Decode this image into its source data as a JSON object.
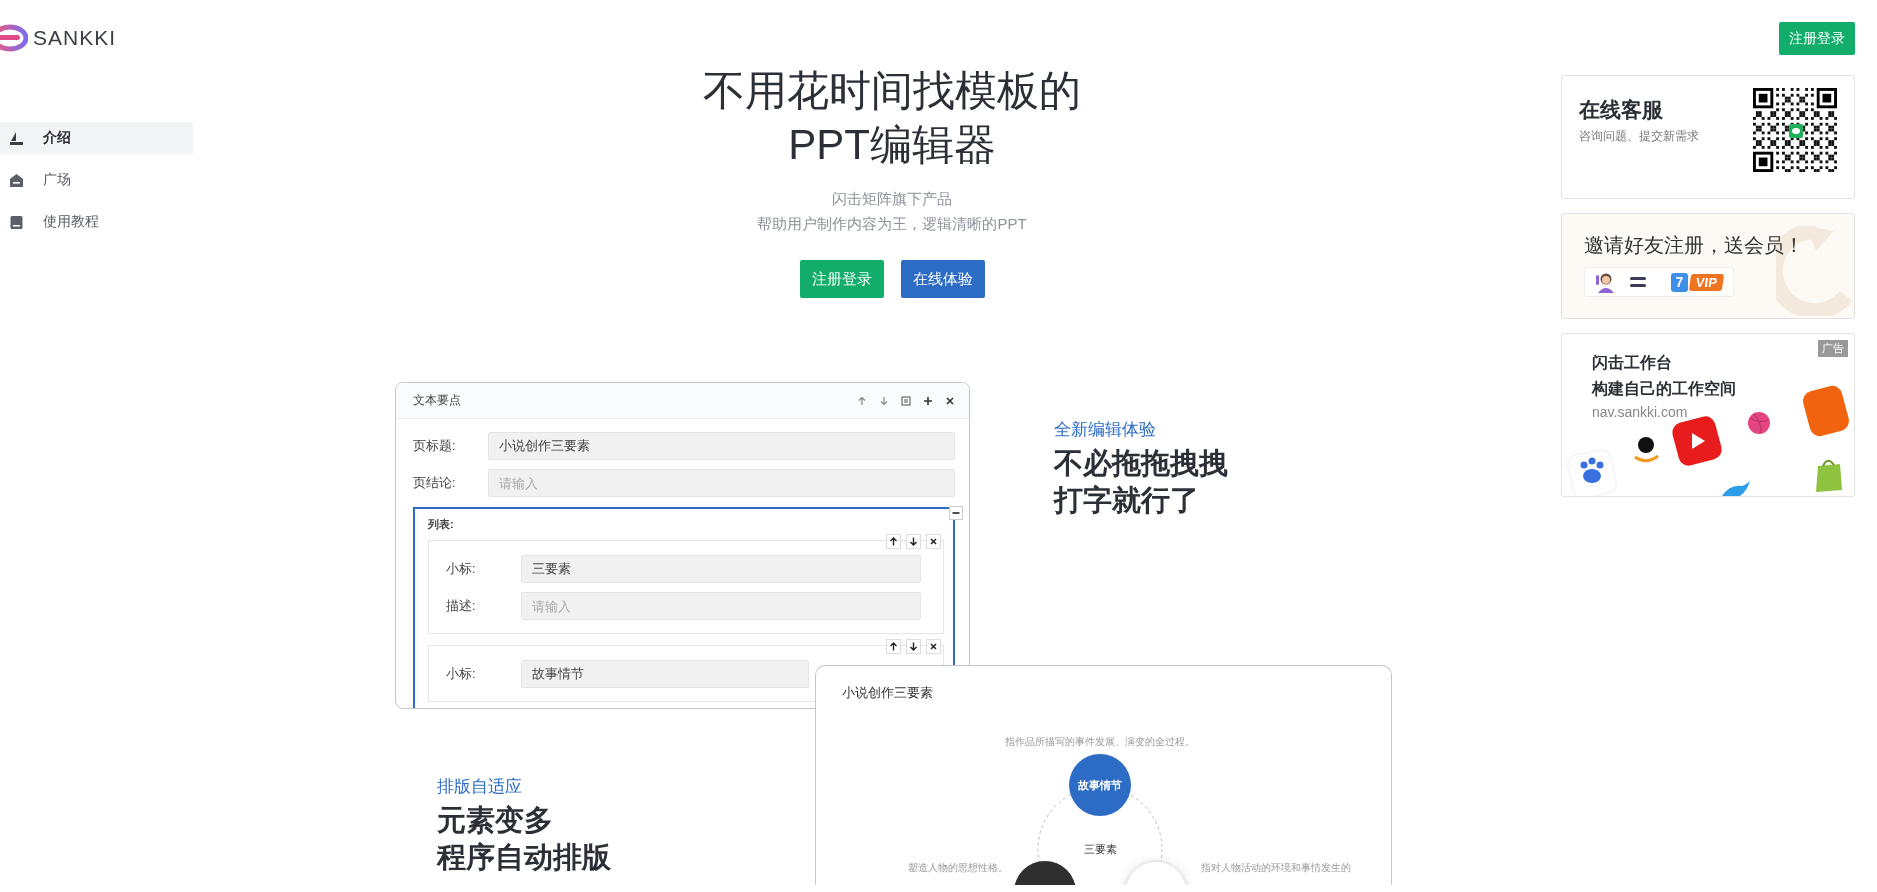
{
  "logo": {
    "text": "SANKKI"
  },
  "sidebar": {
    "items": [
      {
        "label": "介绍",
        "selected": true
      },
      {
        "label": "广场",
        "selected": false
      },
      {
        "label": "使用教程",
        "selected": false
      }
    ]
  },
  "hero": {
    "title_lines": [
      "不用花时间找模板的",
      "PPT编辑器"
    ],
    "subtitle_lines": [
      "闪击矩阵旗下产品",
      "帮助用户制作内容为王，逻辑清晰的PPT"
    ],
    "buttons": [
      {
        "label": "注册登录",
        "kind": "primary"
      },
      {
        "label": "在线体验",
        "kind": "secondary"
      }
    ]
  },
  "editor": {
    "title": "文本要点",
    "fields": [
      {
        "label": "页标题:",
        "value": "小说创作三要素"
      },
      {
        "label": "页结论:",
        "placeholder": "请输入"
      }
    ],
    "list": {
      "label": "列表:",
      "items": [
        {
          "fields": [
            {
              "label": "小标:",
              "value": "三要素"
            },
            {
              "label": "描述:",
              "placeholder": "请输入"
            }
          ]
        },
        {
          "fields": [
            {
              "label": "小标:",
              "value": "故事情节"
            }
          ]
        }
      ]
    }
  },
  "features": [
    {
      "kicker": "全新编辑体验",
      "heading_lines": [
        "不必拖拖拽拽",
        "打字就行了"
      ]
    },
    {
      "kicker": "排版自适应",
      "heading_lines": [
        "元素变多",
        "程序自动排版"
      ]
    }
  ],
  "slide": {
    "title": "小说创作三要素",
    "center_label": "三要素",
    "nodes": [
      {
        "kind": "blue",
        "label": "故事情节",
        "description": "指作品所描写的事件发展、演变的全过程。"
      },
      {
        "kind": "dark",
        "description": "塑造人物的思想性格。"
      },
      {
        "kind": "light",
        "description": "指对人物活动的环境和事情发生的"
      }
    ]
  },
  "aside": {
    "login_button": "注册登录",
    "support_card": {
      "title": "在线客服",
      "subtitle": "咨询问题、提交新需求"
    },
    "invite_card": {
      "title": "邀请好友注册，送会员！",
      "badge_number": "7",
      "badge_label": "VIP"
    },
    "ad_card": {
      "tag": "广告",
      "lines": [
        "闪击工作台",
        "构建自己的工作空间"
      ],
      "url": "nav.sankki.com"
    }
  }
}
